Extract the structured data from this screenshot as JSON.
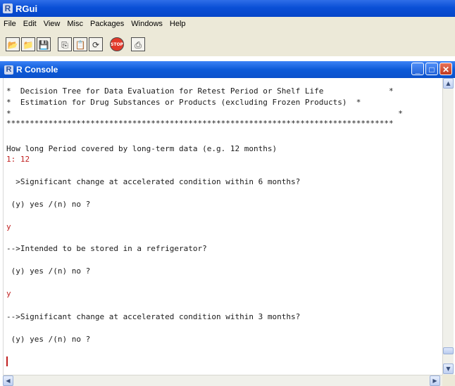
{
  "app": {
    "title": "RGui",
    "logo": "R"
  },
  "menu": [
    "File",
    "Edit",
    "View",
    "Misc",
    "Packages",
    "Windows",
    "Help"
  ],
  "toolbar": [
    {
      "name": "open-script-icon",
      "glyph": "📂"
    },
    {
      "name": "load-workspace-icon",
      "glyph": "📁"
    },
    {
      "name": "save-workspace-icon",
      "glyph": "💾"
    },
    {
      "name": "copy-icon",
      "glyph": "⎘"
    },
    {
      "name": "paste-icon",
      "glyph": "📋"
    },
    {
      "name": "copy-paste-icon",
      "glyph": "⟳"
    },
    {
      "name": "stop-icon",
      "glyph": "STOP"
    },
    {
      "name": "print-icon",
      "glyph": "⎙"
    }
  ],
  "console_window": {
    "title": "R Console",
    "logo": "R",
    "minimize": "_",
    "maximize": "□",
    "close": "✕"
  },
  "console_lines": [
    {
      "text": "*  Decision Tree for Data Evaluation for Retest Period or Shelf Life              *",
      "input": false
    },
    {
      "text": "*  Estimation for Drug Substances or Products (excluding Frozen Products)  *",
      "input": false
    },
    {
      "text": "*                                                                                   *",
      "input": false
    },
    {
      "text": "***********************************************************************************",
      "input": false
    },
    {
      "text": "How long Period covered by long-term data (e.g. 12 months)",
      "input": false
    },
    {
      "text": "1: 12",
      "input": true
    },
    {
      "text": "  >Significant change at accelerated condition within 6 months?",
      "input": false
    },
    {
      "text": " (y) yes /(n) no ?",
      "input": false
    },
    {
      "text": "y",
      "input": true
    },
    {
      "text": "-->Intended to be stored in a refrigerator?",
      "input": false
    },
    {
      "text": " (y) yes /(n) no ?",
      "input": false
    },
    {
      "text": "y",
      "input": true
    },
    {
      "text": "-->Significant change at accelerated condition within 3 months?",
      "input": false
    },
    {
      "text": " (y) yes /(n) no ?",
      "input": false
    }
  ],
  "colors": {
    "input": "#c02020",
    "titlebar": "#0a4fd6",
    "chrome": "#ece9d8"
  }
}
